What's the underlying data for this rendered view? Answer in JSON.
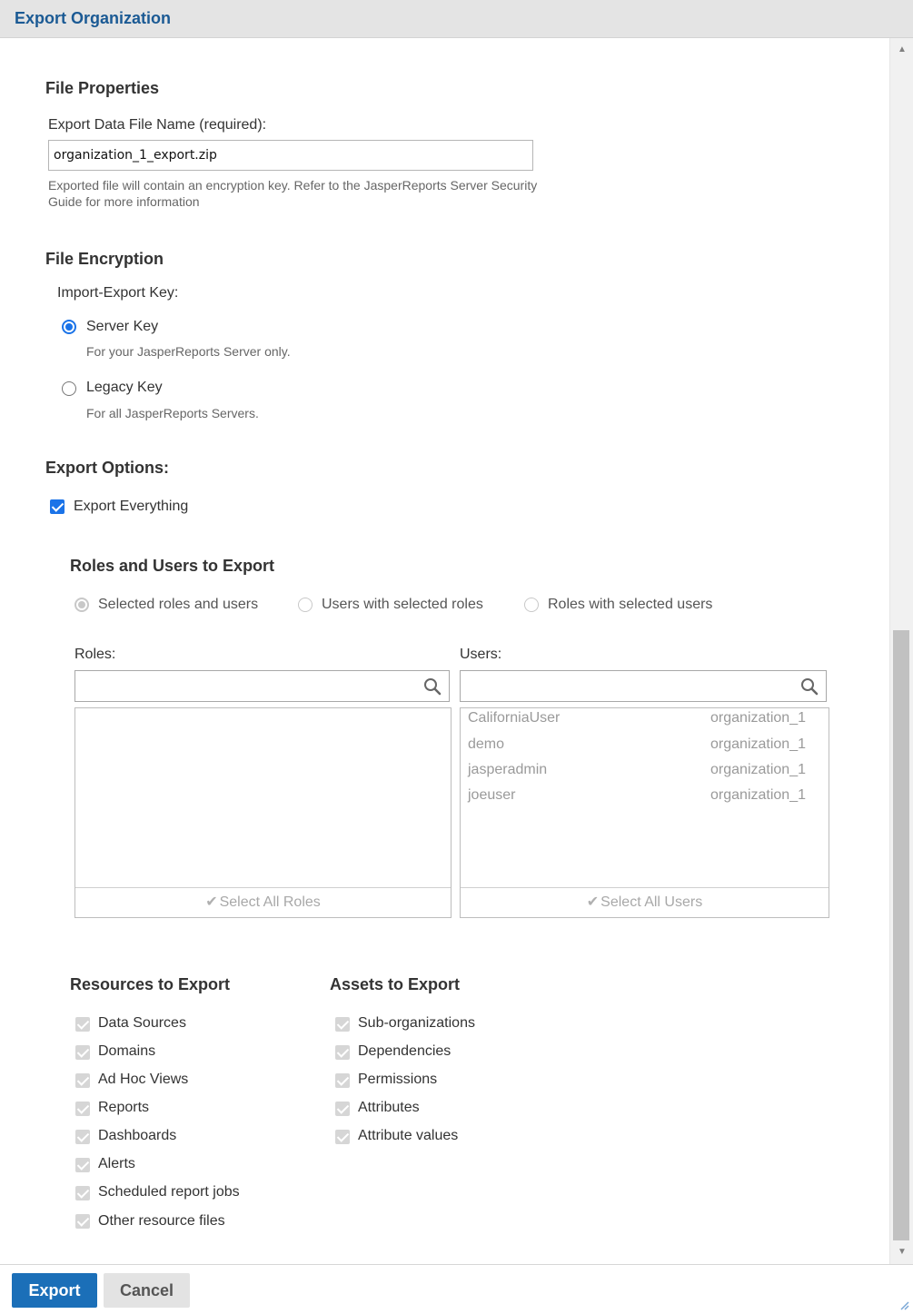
{
  "dialog": {
    "title": "Export Organization"
  },
  "file_properties": {
    "heading": "File Properties",
    "filename_label": "Export Data File Name (required):",
    "filename_value": "organization_1_export.zip",
    "hint": "Exported file will contain an encryption key. Refer to the JasperReports Server Security Guide for more information"
  },
  "file_encryption": {
    "heading": "File Encryption",
    "key_label": "Import-Export Key:",
    "options": [
      {
        "label": "Server Key",
        "desc": "For your JasperReports Server only.",
        "selected": true
      },
      {
        "label": "Legacy Key",
        "desc": "For all JasperReports Servers.",
        "selected": false
      }
    ]
  },
  "export_options": {
    "heading": "Export Options:",
    "export_everything_label": "Export Everything",
    "export_everything_checked": true
  },
  "roles_users": {
    "heading": "Roles and Users to Export",
    "modes": [
      {
        "label": "Selected roles and users",
        "selected": true
      },
      {
        "label": "Users with selected roles",
        "selected": false
      },
      {
        "label": "Roles with selected users",
        "selected": false
      }
    ],
    "roles_label": "Roles:",
    "users_label": "Users:",
    "roles_search_placeholder": "",
    "users_search_placeholder": "",
    "roles": [],
    "users": [
      {
        "name": "CaliforniaUser",
        "org": "organization_1"
      },
      {
        "name": "demo",
        "org": "organization_1"
      },
      {
        "name": "jasperadmin",
        "org": "organization_1"
      },
      {
        "name": "joeuser",
        "org": "organization_1"
      }
    ],
    "select_all_roles": "Select All Roles",
    "select_all_users": "Select All Users"
  },
  "resources": {
    "heading": "Resources to Export",
    "items": [
      "Data Sources",
      "Domains",
      "Ad Hoc Views",
      "Reports",
      "Dashboards",
      "Alerts",
      "Scheduled report jobs",
      "Other resource files"
    ]
  },
  "assets": {
    "heading": "Assets to Export",
    "items": [
      "Sub-organizations",
      "Dependencies",
      "Permissions",
      "Attributes",
      "Attribute values"
    ]
  },
  "buttons": {
    "export": "Export",
    "cancel": "Cancel"
  },
  "colors": {
    "accent": "#1a73e8",
    "title": "#1b5a94",
    "primary_button": "#1b6fb8"
  },
  "icons": {
    "search": "search-icon",
    "check": "check-icon",
    "scroll_up": "scroll-up-arrow-icon",
    "scroll_down": "scroll-down-arrow-icon",
    "resize": "resize-grip-icon"
  }
}
